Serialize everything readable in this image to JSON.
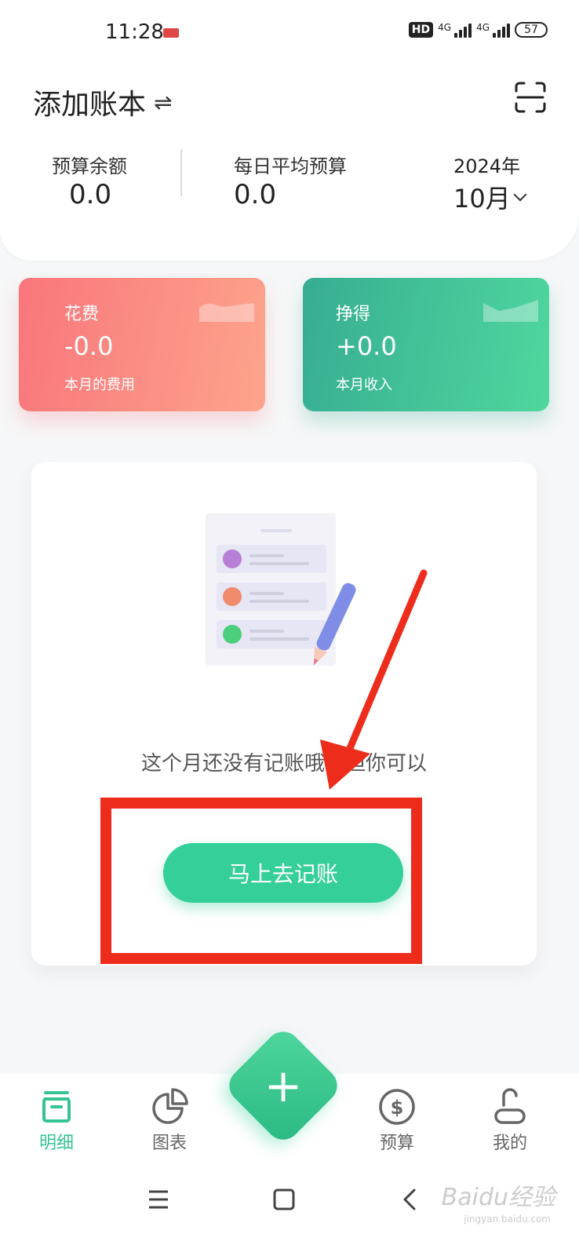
{
  "status_bar": {
    "time": "11:28",
    "hd_label": "HD",
    "network_1": "4G",
    "network_2": "4G",
    "battery": "57"
  },
  "header": {
    "book_title": "添加账本",
    "swap_icon": "swap-icon",
    "scan_icon": "scan-icon",
    "budget_balance_label": "预算余额",
    "budget_balance_value": "0.0",
    "daily_avg_label": "每日平均预算",
    "daily_avg_value": "0.0",
    "year": "2024年",
    "month": "10月"
  },
  "cards": {
    "expense": {
      "title": "花费",
      "value": "-0.0",
      "subtitle": "本月的费用",
      "color": "#f9767b"
    },
    "income": {
      "title": "挣得",
      "value": "+0.0",
      "subtitle": "本月收入",
      "color": "#37ad92"
    }
  },
  "empty_state": {
    "message": "这个月还没有记账哦，但你可以",
    "button_label": "马上去记账"
  },
  "annotation": {
    "color": "#ee2c1c"
  },
  "bottom_nav": {
    "items": [
      {
        "label": "明细",
        "icon": "inbox-icon",
        "active": true
      },
      {
        "label": "图表",
        "icon": "pie-chart-icon",
        "active": false
      },
      {
        "label": "预算",
        "icon": "dollar-icon",
        "active": false
      },
      {
        "label": "我的",
        "icon": "person-icon",
        "active": false
      }
    ],
    "fab_label": "+",
    "accent": "#35c391"
  },
  "system_nav": {
    "watermark": "Baidu经验",
    "watermark_sub": "jingyan.baidu.com"
  }
}
